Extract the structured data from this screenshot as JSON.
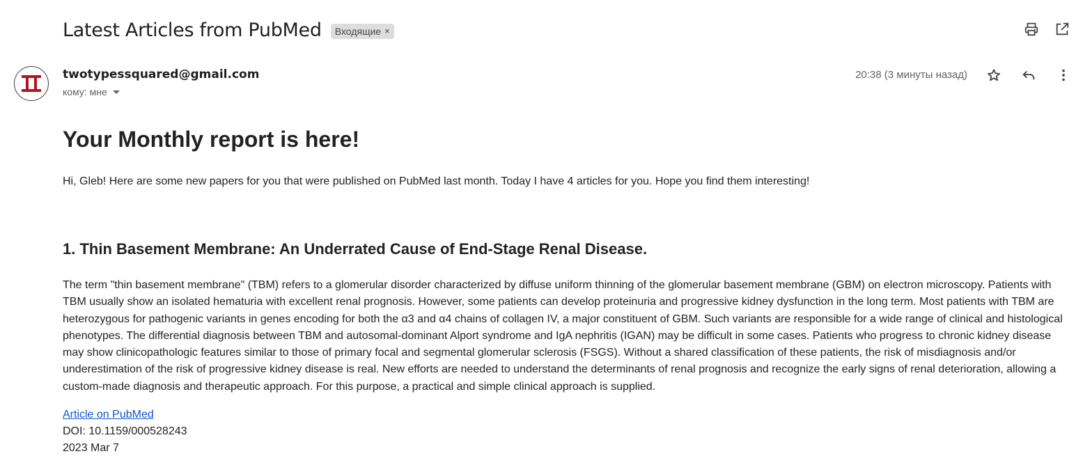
{
  "email": {
    "subject": "Latest Articles from PubMed",
    "label_chip": "Входящие",
    "label_remove_glyph": "×",
    "sender": "twotypessquared@gmail.com",
    "to_line": "кому: мне",
    "timestamp": "20:38 (3 минуты назад)",
    "icons": {
      "print": "print-icon",
      "open_new_window": "open-in-new-window-icon",
      "star": "star-icon",
      "reply": "reply-icon",
      "more": "more-vert-icon",
      "avatar": "avatar-logo-icon"
    },
    "avatar_colors": {
      "accent": "#b3121e",
      "outline": "#3c3c3c"
    }
  },
  "body": {
    "title": "Your Monthly report is here!",
    "greeting": "Hi, Gleb! Here are some new papers for you that were published on PubMed last month. Today I have 4 articles for you. Hope you find them interesting!",
    "articles": [
      {
        "title": "1. Thin Basement Membrane: An Underrated Cause of End-Stage Renal Disease.",
        "abstract": "The term \"thin basement membrane\" (TBM) refers to a glomerular disorder characterized by diffuse uniform thinning of the glomerular basement membrane (GBM) on electron microscopy. Patients with TBM usually show an isolated hematuria with excellent renal prognosis. However, some patients can develop proteinuria and progressive kidney dysfunction in the long term. Most patients with TBM are heterozygous for pathogenic variants in genes encoding for both the α3 and α4 chains of collagen IV, a major constituent of GBM. Such variants are responsible for a wide range of clinical and histological phenotypes. The differential diagnosis between TBM and autosomal-dominant Alport syndrome and IgA nephritis (IGAN) may be difficult in some cases. Patients who progress to chronic kidney disease may show clinicopathologic features similar to those of primary focal and segmental glomerular sclerosis (FSGS). Without a shared classification of these patients, the risk of misdiagnosis and/or underestimation of the risk of progressive kidney disease is real. New efforts are needed to understand the determinants of renal prognosis and recognize the early signs of renal deterioration, allowing a custom-made diagnosis and therapeutic approach. For this purpose, a practical and simple clinical approach is supplied.",
        "link_label": "Article on PubMed",
        "doi": "DOI: 10.1159/000528243",
        "date": "2023 Mar 7"
      }
    ]
  },
  "colors": {
    "link": "#1155cc",
    "chip_bg": "#dddddd",
    "muted_text": "#5f6368"
  }
}
